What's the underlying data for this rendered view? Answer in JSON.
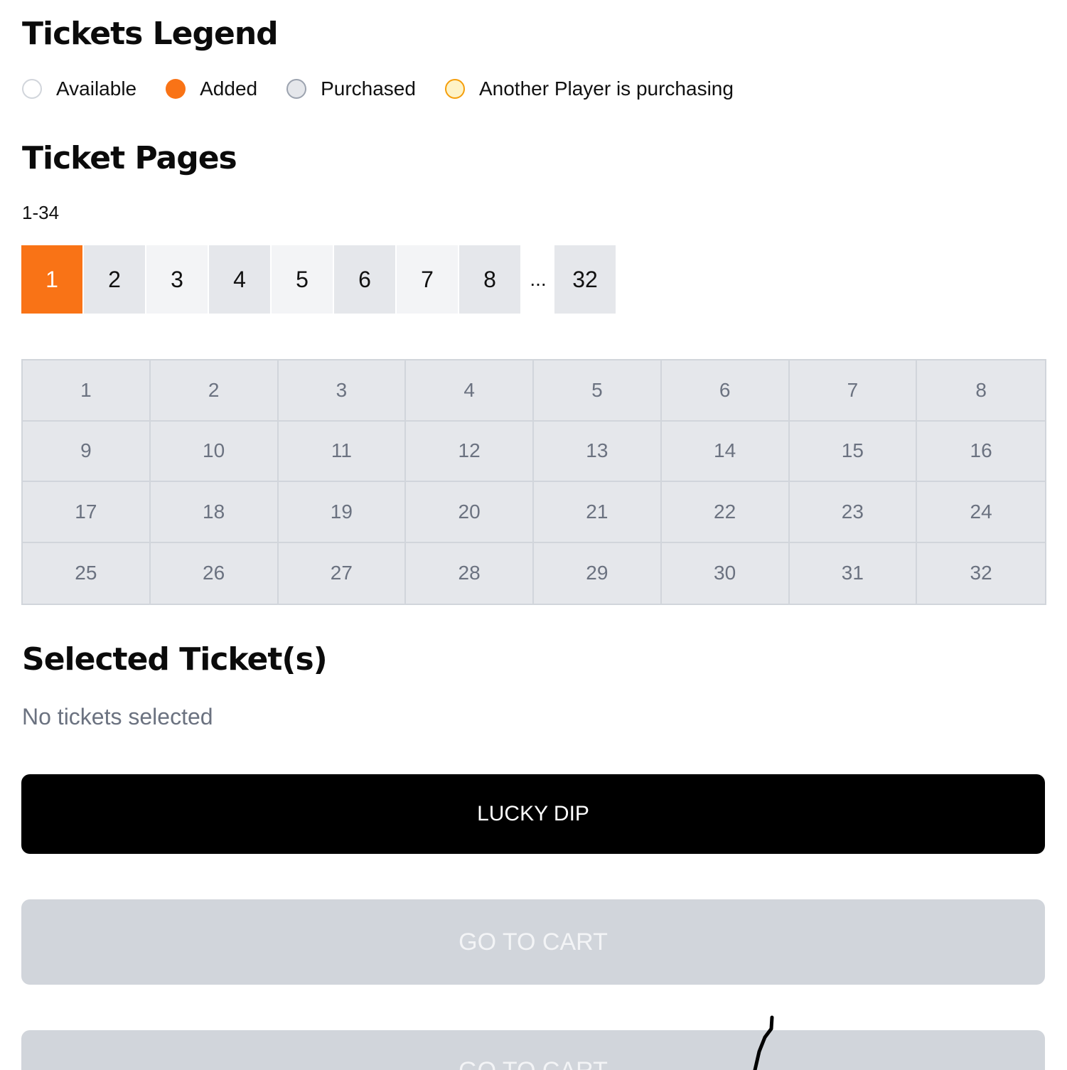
{
  "legend": {
    "title": "Tickets Legend",
    "items": [
      {
        "label": "Available",
        "color": "#ffffff"
      },
      {
        "label": "Added",
        "color": "#f97316"
      },
      {
        "label": "Purchased",
        "color": "#e5e7eb"
      },
      {
        "label": "Another Player is purchasing",
        "color": "#fef3c7"
      }
    ]
  },
  "pages": {
    "title": "Ticket Pages",
    "range": "1-34",
    "buttons": [
      "1",
      "2",
      "3",
      "4",
      "5",
      "6",
      "7",
      "8"
    ],
    "ellipsis": "...",
    "last": "32",
    "active": "1",
    "active_color": "#f97316"
  },
  "tickets": [
    "1",
    "2",
    "3",
    "4",
    "5",
    "6",
    "7",
    "8",
    "9",
    "10",
    "11",
    "12",
    "13",
    "14",
    "15",
    "16",
    "17",
    "18",
    "19",
    "20",
    "21",
    "22",
    "23",
    "24",
    "25",
    "26",
    "27",
    "28",
    "29",
    "30",
    "31",
    "32"
  ],
  "selected": {
    "title": "Selected Ticket(s)",
    "empty_text": "No tickets selected"
  },
  "actions": {
    "lucky_dip": "LUCKY DIP",
    "go_to_cart": "GO TO CART",
    "go_to_cart_2": "GO TO CART"
  }
}
